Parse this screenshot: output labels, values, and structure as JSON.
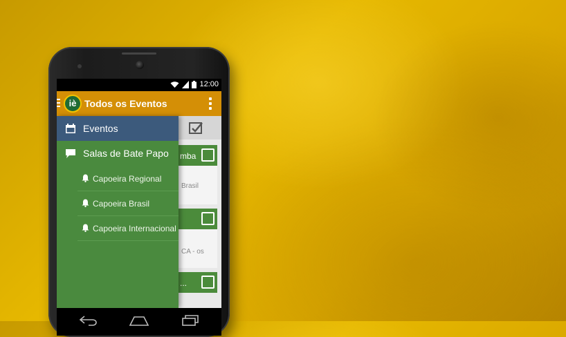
{
  "status": {
    "time": "12:00"
  },
  "appbar": {
    "title": "Todos os Eventos",
    "logo_text": "iè"
  },
  "drawer": {
    "items": [
      {
        "label": "Eventos"
      },
      {
        "label": "Salas de Bate Papo"
      }
    ],
    "sub_items": [
      {
        "label": "Capoeira Regional"
      },
      {
        "label": "Capoeira Brasil"
      },
      {
        "label": "Capoeira Internacional"
      }
    ]
  },
  "background_cards": [
    {
      "title": "mba",
      "body": "Brasil"
    },
    {
      "title": "",
      "body": "CA - os"
    },
    {
      "title": "...",
      "body": ""
    }
  ],
  "colors": {
    "appbar": "#d48f06",
    "drawer": "#4a8a3e",
    "drawer_active": "#3c5a7c"
  }
}
